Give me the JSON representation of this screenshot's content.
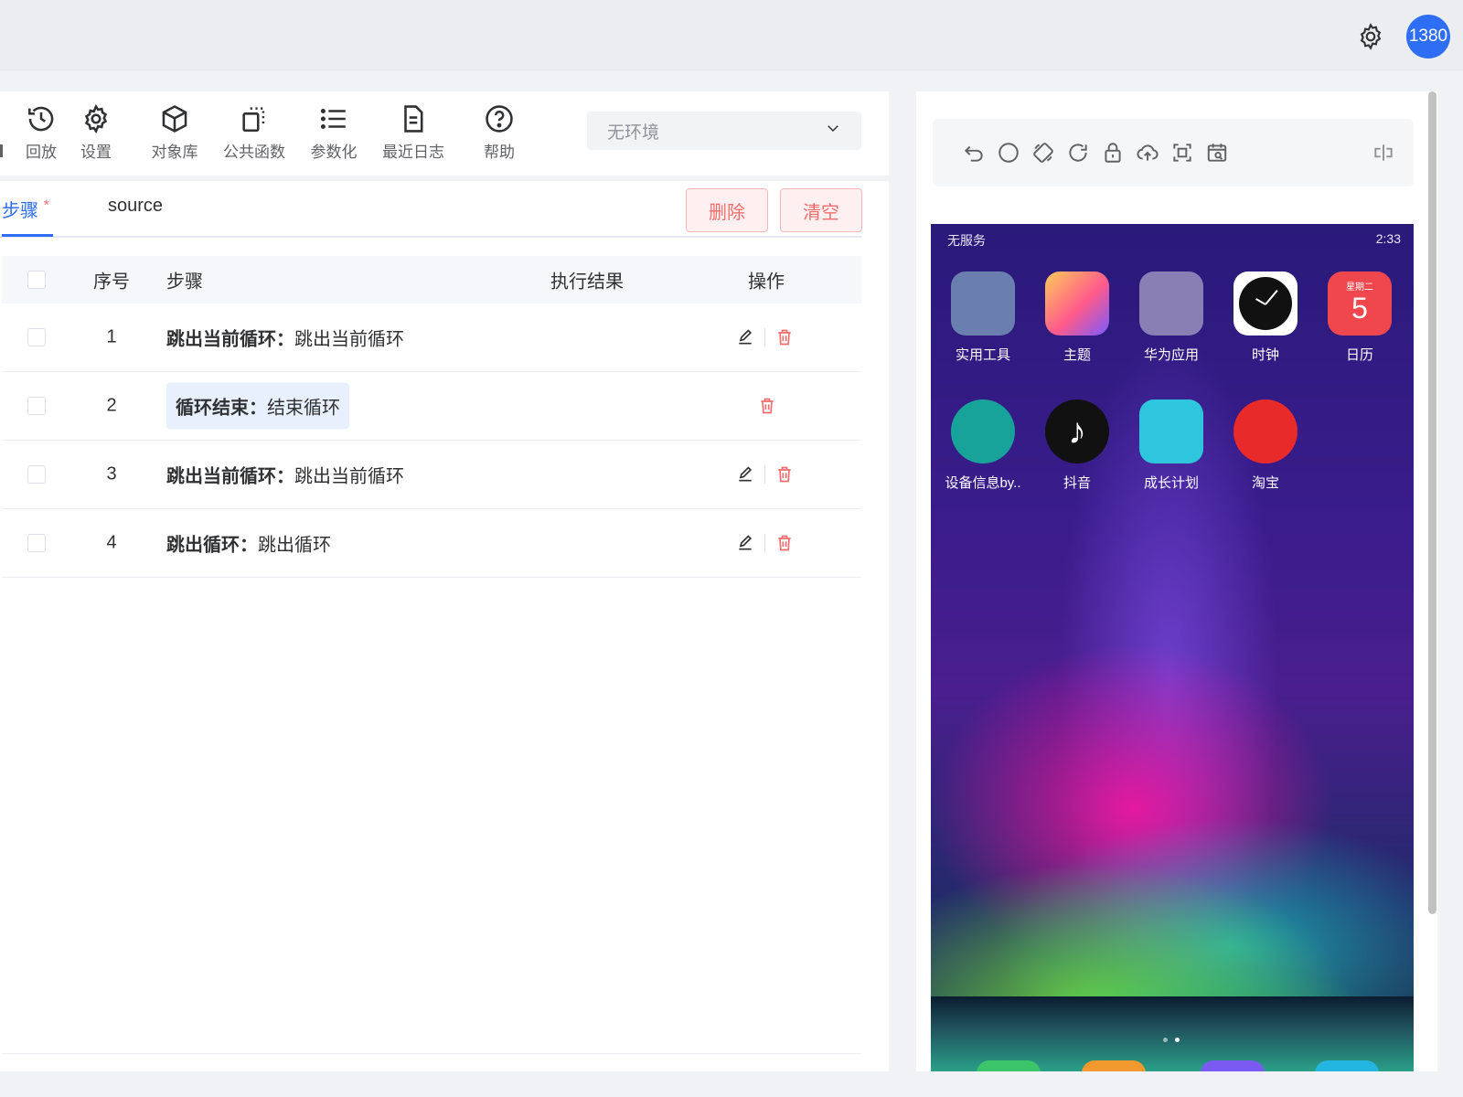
{
  "header": {
    "avatar_text": "1380",
    "icon": "gear-icon"
  },
  "toolbar": {
    "items": [
      {
        "label": "回放",
        "icon": "history-icon"
      },
      {
        "label": "设置",
        "icon": "gear-icon"
      },
      {
        "label": "对象库",
        "icon": "cube-icon"
      },
      {
        "label": "公共函数",
        "icon": "function-icon"
      },
      {
        "label": "参数化",
        "icon": "list-icon"
      },
      {
        "label": "最近日志",
        "icon": "document-icon"
      },
      {
        "label": "帮助",
        "icon": "help-icon"
      }
    ],
    "env_select": {
      "value": "无环境"
    }
  },
  "tabs": {
    "steps": "步骤",
    "steps_required": "*",
    "source": "source"
  },
  "actions": {
    "delete": "删除",
    "clear": "清空"
  },
  "table": {
    "headers": {
      "index": "序号",
      "step": "步骤",
      "result": "执行结果",
      "op": "操作"
    },
    "rows": [
      {
        "index": "1",
        "key": "跳出当前循环：",
        "value": "跳出当前循环",
        "editable": true
      },
      {
        "index": "2",
        "key": "循环结束：",
        "value": "结束循环",
        "editable": false
      },
      {
        "index": "3",
        "key": "跳出当前循环：",
        "value": "跳出当前循环",
        "editable": true
      },
      {
        "index": "4",
        "key": "跳出循环：",
        "value": "跳出循环",
        "editable": true
      }
    ]
  },
  "device": {
    "toolbar_icons": [
      "undo-icon",
      "home-circle-icon",
      "rotate-icon",
      "refresh-icon",
      "lock-icon",
      "upload-cloud-icon",
      "screenshot-icon",
      "calendar-search-icon",
      "split-view-icon"
    ],
    "status_left": "无服务",
    "status_right": "2:33",
    "apps_row1": [
      {
        "name": "实用工具",
        "color": "#6a7eb0"
      },
      {
        "name": "主题",
        "color": "#ff8a6a"
      },
      {
        "name": "华为应用",
        "color": "#8a7fb5"
      },
      {
        "name": "时钟",
        "color": "#ffffff"
      },
      {
        "name": "日历",
        "color": "#f0474e",
        "date": "5",
        "weekday": "星期二"
      }
    ],
    "apps_row2": [
      {
        "name": "设备信息by..",
        "color": "#18a39a"
      },
      {
        "name": "抖音",
        "color": "#111111"
      },
      {
        "name": "成长计划",
        "color": "#2ec6dc"
      },
      {
        "name": "淘宝",
        "color": "#e82a2a"
      }
    ]
  }
}
